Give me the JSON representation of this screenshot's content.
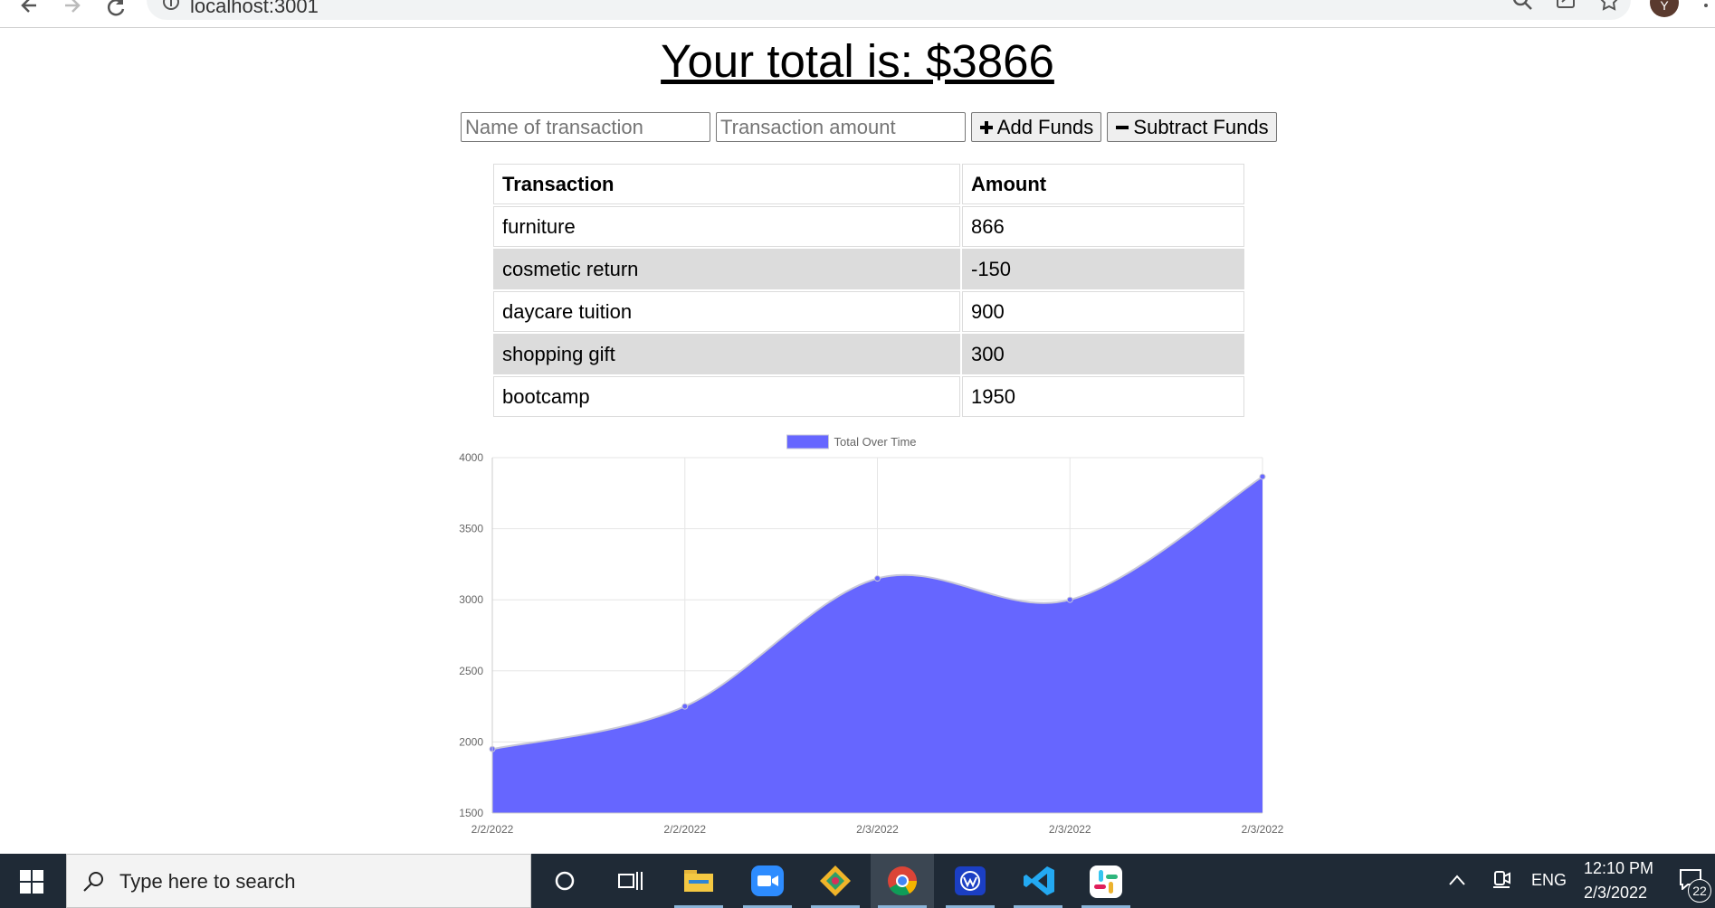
{
  "browser": {
    "url": "localhost:3001",
    "profile_initial": "Y"
  },
  "page": {
    "title": "Your total is: $3866"
  },
  "form": {
    "name_placeholder": "Name of transaction",
    "amount_placeholder": "Transaction amount",
    "add_label": "Add Funds",
    "subtract_label": "Subtract Funds"
  },
  "table": {
    "headers": [
      "Transaction",
      "Amount"
    ],
    "rows": [
      {
        "name": "furniture",
        "amount": "866"
      },
      {
        "name": "cosmetic return",
        "amount": "-150"
      },
      {
        "name": "daycare tuition",
        "amount": "900"
      },
      {
        "name": "shopping gift",
        "amount": "300"
      },
      {
        "name": "bootcamp",
        "amount": "1950"
      }
    ]
  },
  "chart_data": {
    "type": "area",
    "x": [
      "2/2/2022",
      "2/2/2022",
      "2/3/2022",
      "2/3/2022",
      "2/3/2022"
    ],
    "series": [
      {
        "name": "Total Over Time",
        "values": [
          1950,
          2250,
          3150,
          3000,
          3866
        ],
        "color": "#6666ff"
      }
    ],
    "y_ticks": [
      1500,
      2000,
      2500,
      3000,
      3500,
      4000
    ],
    "ylim": [
      1500,
      4000
    ],
    "grid": true,
    "legend_position": "top-center"
  },
  "taskbar": {
    "search_placeholder": "Type here to search",
    "language": "ENG",
    "time": "12:10 PM",
    "date": "2/3/2022",
    "notification_count": "22",
    "apps": [
      "cortana-icon",
      "task-view-icon",
      "file-explorer-icon",
      "zoom-icon",
      "git-kraken-icon",
      "chrome-icon",
      "wps-office-icon",
      "vscode-icon",
      "slack-icon"
    ]
  }
}
